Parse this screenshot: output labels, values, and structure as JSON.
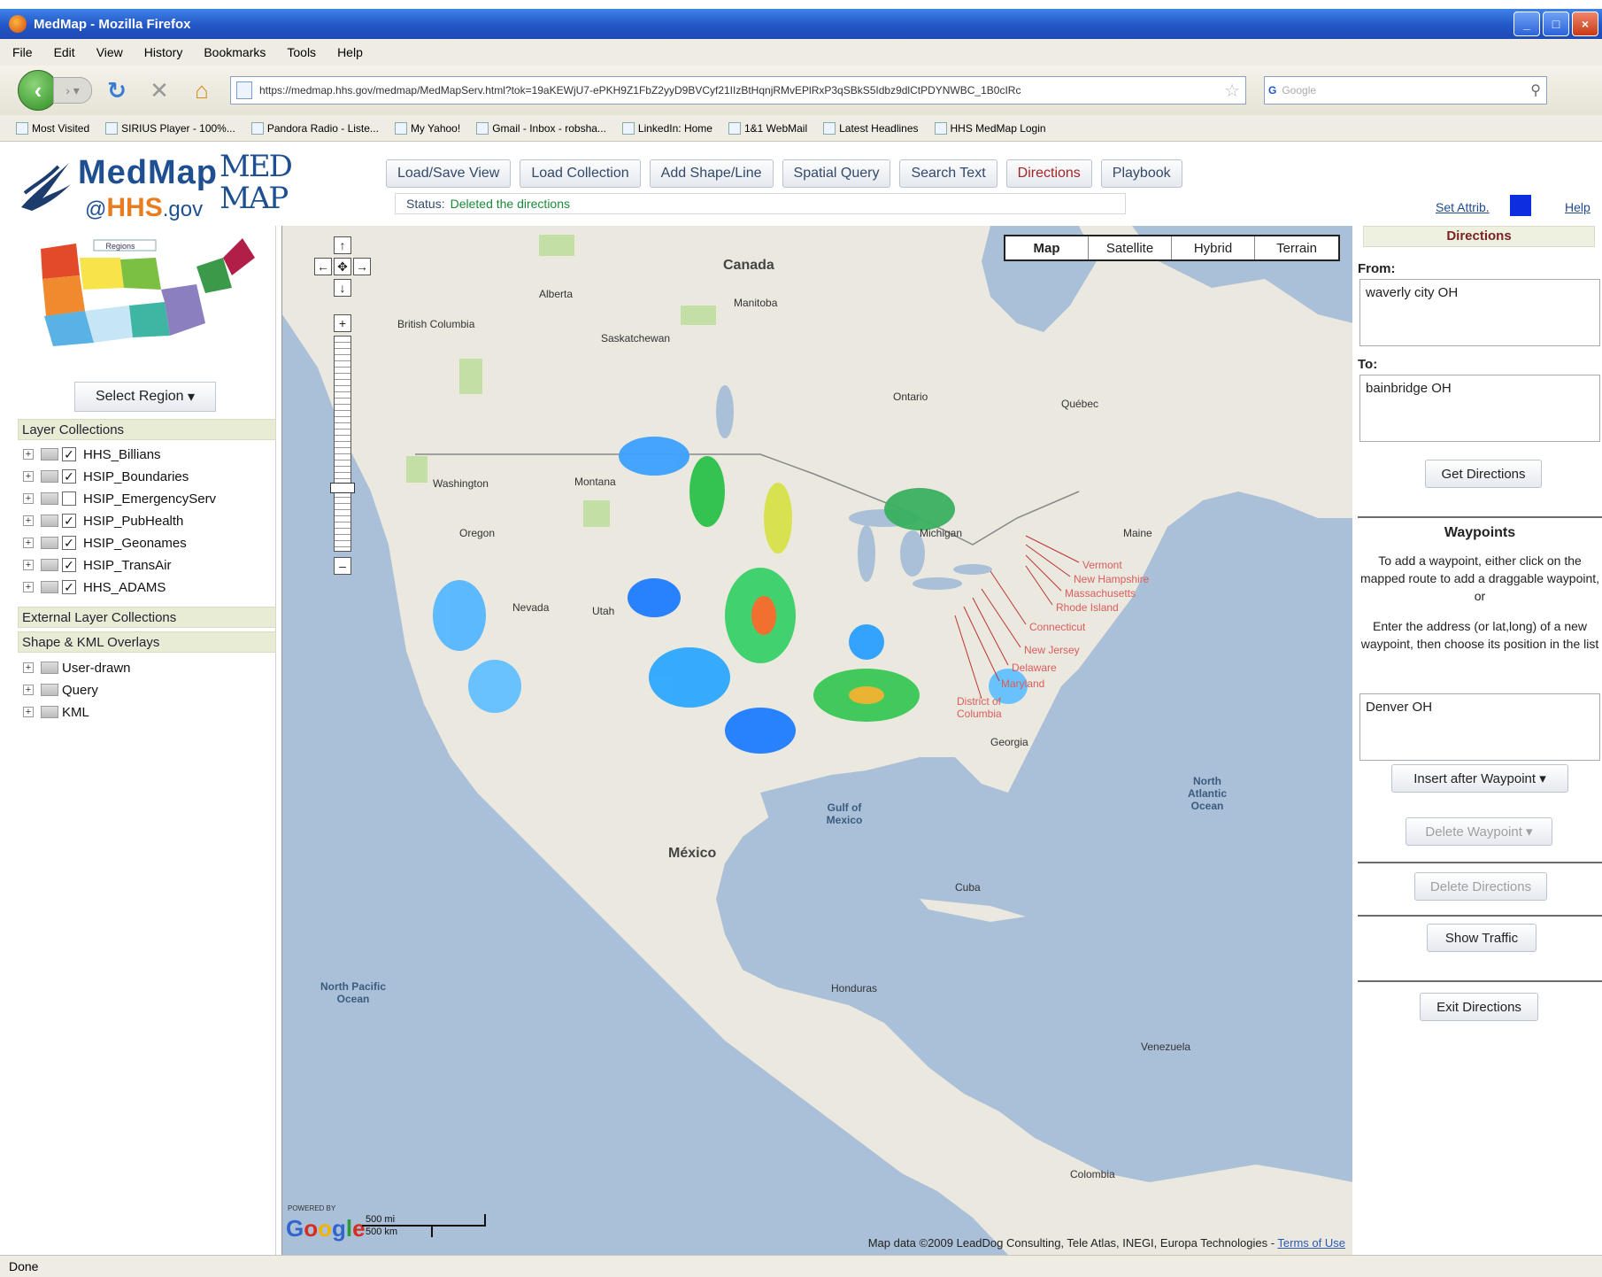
{
  "window": {
    "title": "MedMap - Mozilla Firefox",
    "controls": [
      "_",
      "□",
      "×"
    ]
  },
  "menu": [
    "File",
    "Edit",
    "View",
    "History",
    "Bookmarks",
    "Tools",
    "Help"
  ],
  "nav": {
    "url": "https://medmap.hhs.gov/medmap/MedMapServ.html?tok=19aKEWjU7-ePKH9Z1FbZ2yyD9BVCyf21IIzBtHqnjRMvEPlRxP3qSBkS5Idbz9dlCtPDYNWBC_1B0cIRc",
    "search_placeholder": "Google",
    "search_engine": "G"
  },
  "bookmarks": [
    "Most Visited",
    "SIRIUS Player - 100%...",
    "Pandora Radio - Liste...",
    "My Yahoo!",
    "Gmail - Inbox - robsha...",
    "LinkedIn: Home",
    "1&1 WebMail",
    "Latest Headlines",
    "HHS MedMap Login"
  ],
  "app": {
    "logo": {
      "line1": "MedMap",
      "line2_at": "@",
      "line2_hhs": "HHS",
      "line2_gov": ".gov",
      "mark": "MED MAP"
    },
    "toolbar": [
      "Load/Save View",
      "Load Collection",
      "Add Shape/Line",
      "Spatial Query",
      "Search Text",
      "Directions",
      "Playbook"
    ],
    "status_label": "Status:",
    "status_value": "Deleted the directions",
    "set_attrib": "Set Attrib.",
    "help": "Help",
    "attrib_color": "#0a2ee0"
  },
  "left": {
    "regions_title": "Regions",
    "select_region": "Select Region",
    "layer_collections": "Layer Collections",
    "layers": [
      {
        "name": "HHS_Billians",
        "checked": true
      },
      {
        "name": "HSIP_Boundaries",
        "checked": true
      },
      {
        "name": "HSIP_EmergencyServ",
        "checked": false
      },
      {
        "name": "HSIP_PubHealth",
        "checked": true
      },
      {
        "name": "HSIP_Geonames",
        "checked": true
      },
      {
        "name": "HSIP_TransAir",
        "checked": true
      },
      {
        "name": "HHS_ADAMS",
        "checked": true
      }
    ],
    "external": "External Layer Collections",
    "overlays": "Shape & KML Overlays",
    "overlay_items": [
      "User-drawn",
      "Query",
      "KML"
    ]
  },
  "map": {
    "types": [
      "Map",
      "Satellite",
      "Hybrid",
      "Terrain"
    ],
    "active_type": "Map",
    "labels": {
      "canada": "Canada",
      "mexico": "México",
      "north_atlantic": "North Atlantic Ocean",
      "north_pacific": "North Pacific Ocean",
      "gulf": "Gulf of Mexico",
      "alberta": "Alberta",
      "manitoba": "Manitoba",
      "saskatchewan": "Saskatchewan",
      "british_columbia": "British Columbia",
      "ontario": "Ontario",
      "quebec": "Québec",
      "montana": "Montana",
      "oregon": "Oregon",
      "nevada": "Nevada",
      "utah": "Utah",
      "washington": "Washington",
      "michigan": "Michigan",
      "georgia": "Georgia",
      "cuba": "Cuba",
      "venezuela": "Venezuela",
      "colombia": "Colombia",
      "honduras": "Honduras",
      "vermont": "Vermont",
      "new_hampshire": "New Hampshire",
      "massachusetts": "Massachusetts",
      "rhode_island": "Rhode Island",
      "connecticut": "Connecticut",
      "new_jersey": "New Jersey",
      "delaware": "Delaware",
      "maryland": "Maryland",
      "dc": "District of Columbia",
      "maine": "Maine"
    },
    "powered": "POWERED BY",
    "google": [
      "G",
      "o",
      "o",
      "g",
      "l",
      "e"
    ],
    "scale_mi": "500 mi",
    "scale_km": "500 km",
    "attribution": "Map data ©2009 LeadDog Consulting, Tele Atlas, INEGI, Europa Technologies -",
    "terms": "Terms of Use"
  },
  "directions": {
    "title": "Directions",
    "from_label": "From:",
    "from_value": "waverly city OH",
    "to_label": "To:",
    "to_value": "bainbridge OH",
    "get_btn": "Get Directions",
    "waypoints_title": "Waypoints",
    "wp_help1": "To add a waypoint, either click on the mapped route to add a draggable waypoint, or",
    "wp_help2": "Enter the address (or lat,long) of a new waypoint, then choose its position in the list",
    "wp_value": "Denver OH",
    "insert_btn": "Insert after Waypoint",
    "delete_wp_btn": "Delete Waypoint",
    "delete_dir_btn": "Delete Directions",
    "traffic_btn": "Show Traffic",
    "exit_btn": "Exit Directions"
  },
  "statusbar": {
    "text": "Done"
  }
}
